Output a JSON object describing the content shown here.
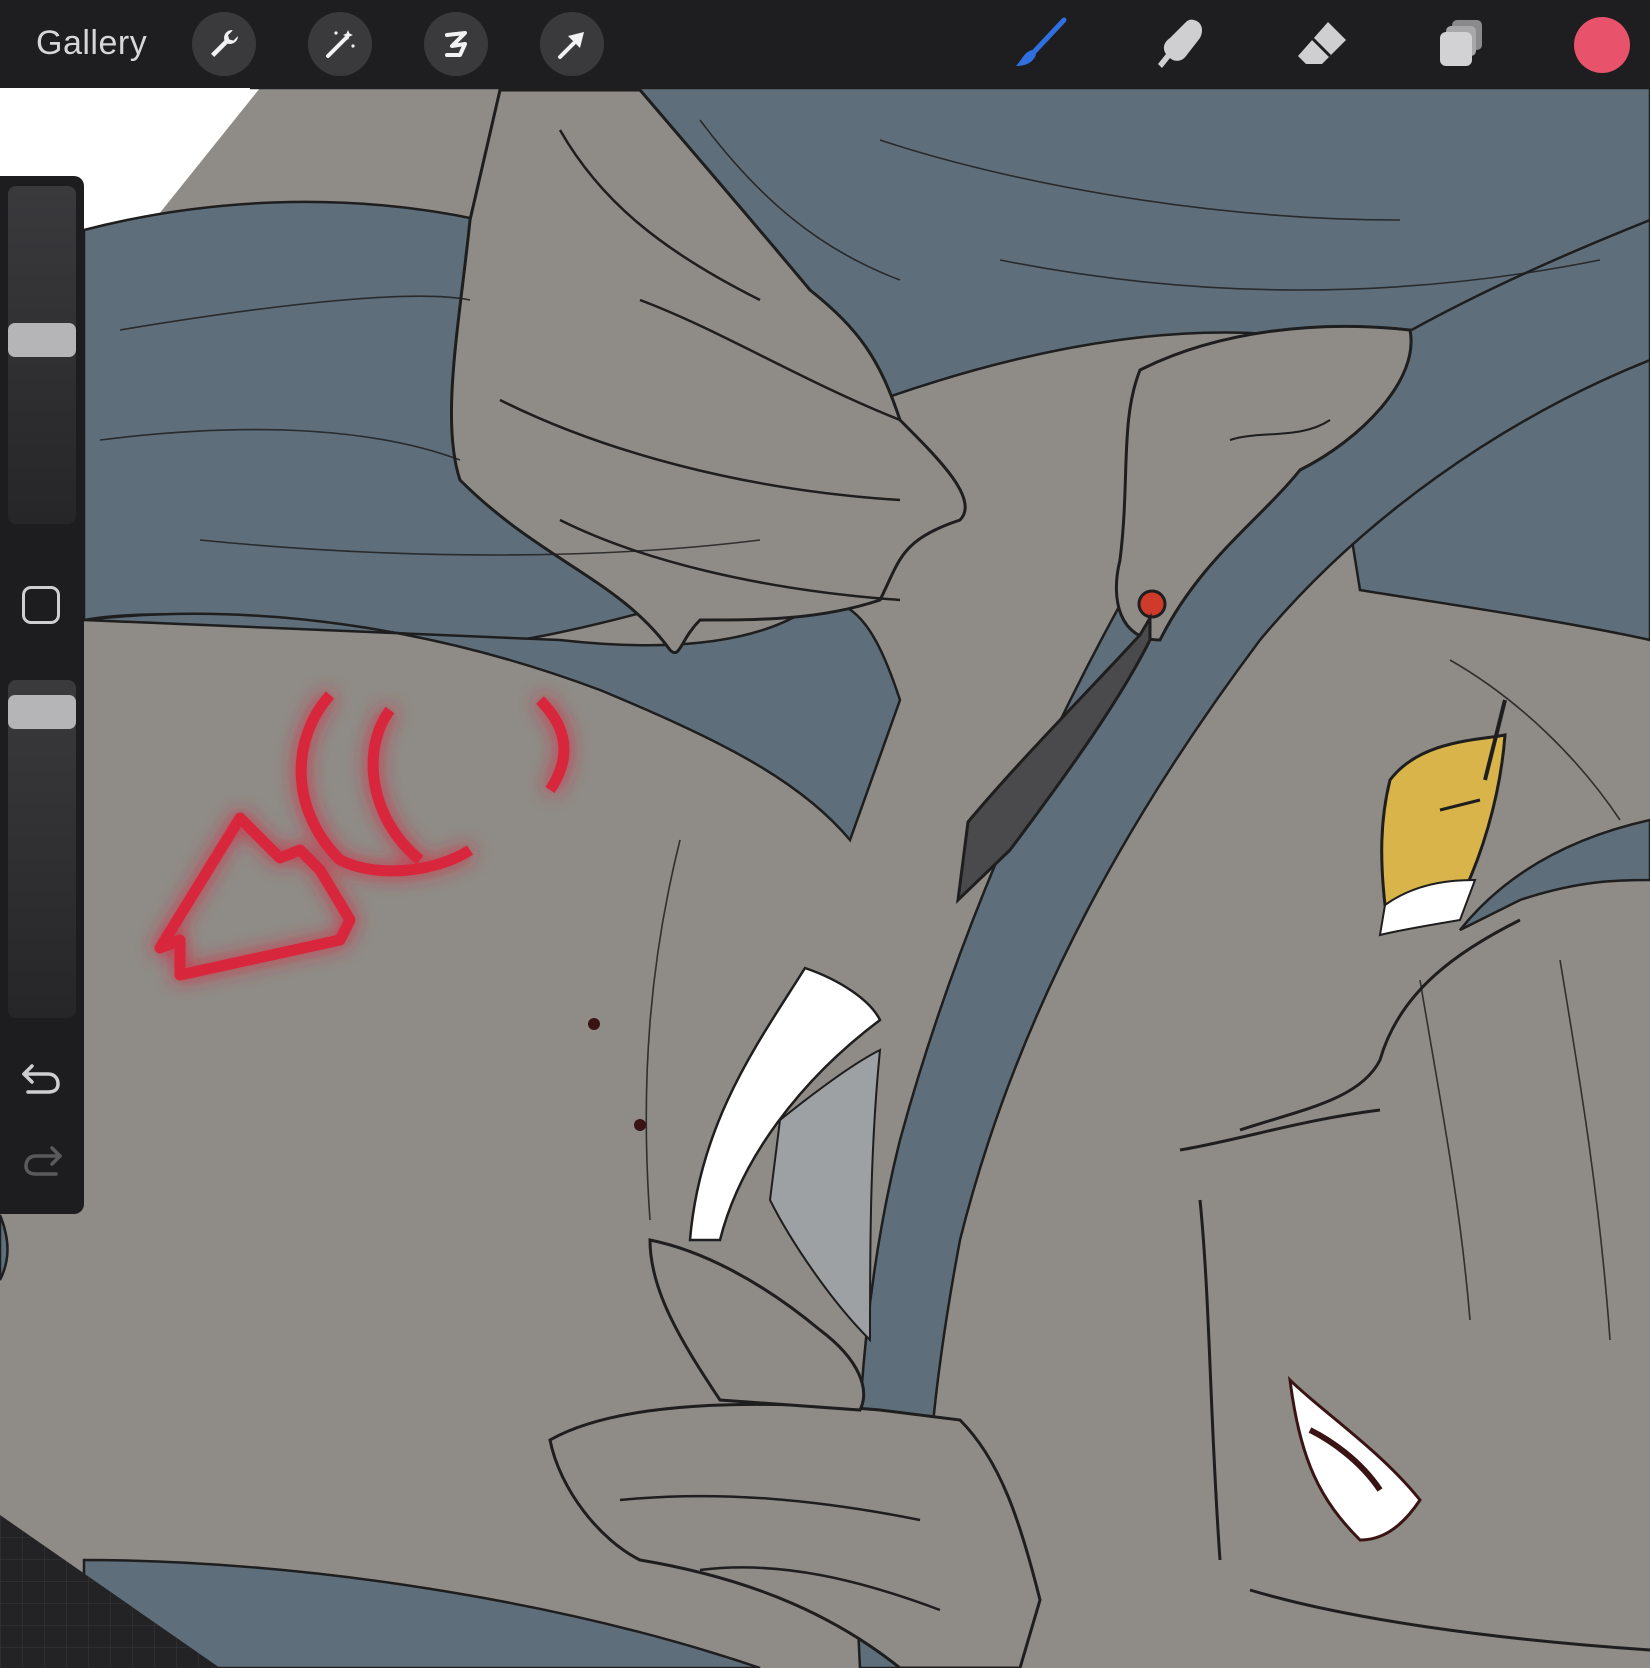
{
  "toolbar": {
    "gallery_label": "Gallery",
    "left_tools": [
      {
        "name": "actions",
        "icon": "wrench-icon"
      },
      {
        "name": "adjustments",
        "icon": "magic-wand-icon"
      },
      {
        "name": "selection",
        "icon": "selection-s-icon"
      },
      {
        "name": "transform",
        "icon": "arrow-cursor-icon"
      }
    ],
    "right_tools": [
      {
        "name": "brush",
        "icon": "brush-icon",
        "active": true,
        "color": "#2f6fe0"
      },
      {
        "name": "smudge",
        "icon": "smudge-finger-icon"
      },
      {
        "name": "eraser",
        "icon": "eraser-icon"
      },
      {
        "name": "layers",
        "icon": "layers-icon"
      }
    ],
    "current_color": "#e8526b"
  },
  "sidebar": {
    "brush_size_level": 0.55,
    "opacity_level": 0.95,
    "modify_icon": "square-modify-icon",
    "undo_icon": "undo-arrow-icon",
    "redo_icon": "redo-arrow-icon"
  },
  "canvas": {
    "palette": {
      "skin": "#8f8b86",
      "hair": "#5e6e7a",
      "line": "#1e1e1e",
      "glow": "#d8263e",
      "eye": "#d8b44a",
      "earring": "#4a4a4c",
      "gem": "#cf3a2a",
      "highlight": "#ffffff"
    }
  }
}
